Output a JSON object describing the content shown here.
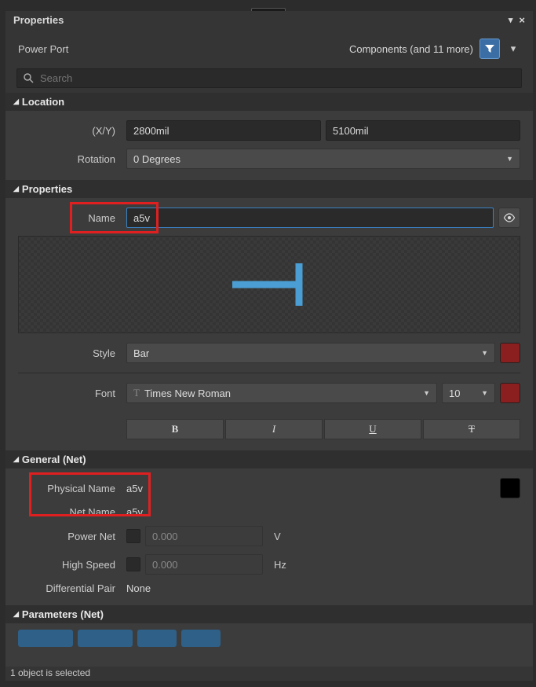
{
  "panel": {
    "title": "Properties",
    "context_object": "Power Port",
    "filter_text": "Components (and 11 more)",
    "search_placeholder": "Search"
  },
  "location": {
    "header": "Location",
    "xy_label": "(X/Y)",
    "x": "2800mil",
    "y": "5100mil",
    "rotation_label": "Rotation",
    "rotation_value": "0 Degrees"
  },
  "properties": {
    "header": "Properties",
    "name_label": "Name",
    "name_value": "a5v",
    "style_label": "Style",
    "style_value": "Bar",
    "style_color": "#8b1e1e",
    "font_label": "Font",
    "font_family": "Times New Roman",
    "font_size": "10",
    "font_color": "#8b1e1e",
    "bold": "B",
    "italic": "I",
    "underline": "U",
    "strike": "T"
  },
  "general_net": {
    "header": "General (Net)",
    "physical_name_label": "Physical Name",
    "physical_name_value": "a5v",
    "net_name_label": "Net Name",
    "net_name_value": "a5v",
    "power_net_label": "Power Net",
    "power_net_value": "0.000",
    "power_net_unit": "V",
    "high_speed_label": "High Speed",
    "high_speed_value": "0.000",
    "high_speed_unit": "Hz",
    "diff_pair_label": "Differential Pair",
    "diff_pair_value": "None",
    "net_color": "#000000"
  },
  "parameters_net": {
    "header": "Parameters (Net)"
  },
  "status": "1 object is selected"
}
